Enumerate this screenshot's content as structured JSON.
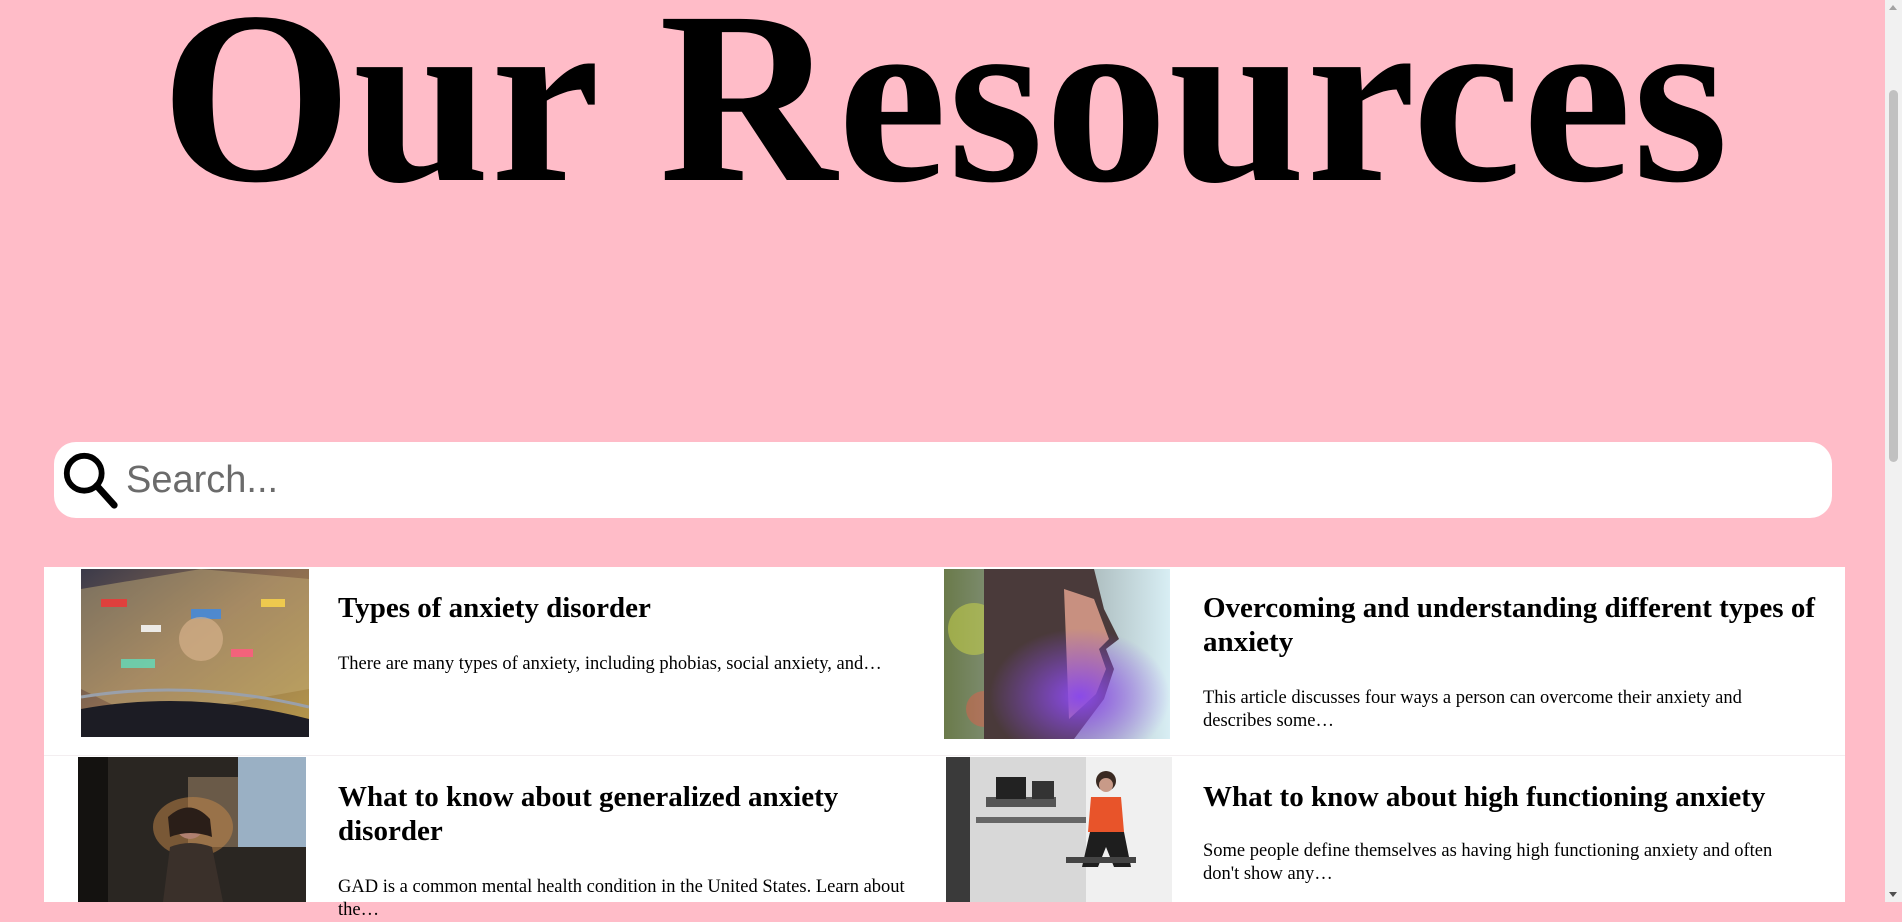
{
  "header": {
    "title": "Our Resources"
  },
  "search": {
    "placeholder": "Search...",
    "value": "",
    "icon": "search-icon"
  },
  "articles": [
    {
      "title": "Types of anxiety disorder",
      "excerpt": "There are many types of anxiety, including phobias, social anxiety, and…",
      "image": "blurred-car-window-lights-photo"
    },
    {
      "title": "Overcoming and understanding different types of anxiety",
      "excerpt": "This article discusses four ways a person can overcome their anxiety and describes some…",
      "image": "face-profile-with-colorful-light-photo"
    },
    {
      "title": "What to know about generalized anxiety disorder",
      "excerpt": "GAD is a common mental health condition in the United States. Learn about the…",
      "image": "woman-in-dim-room-photo"
    },
    {
      "title": "What to know about high functioning anxiety",
      "excerpt": "Some people define themselves as having high functioning anxiety and often don't show any…",
      "image": "woman-sitting-in-office-photo"
    }
  ]
}
